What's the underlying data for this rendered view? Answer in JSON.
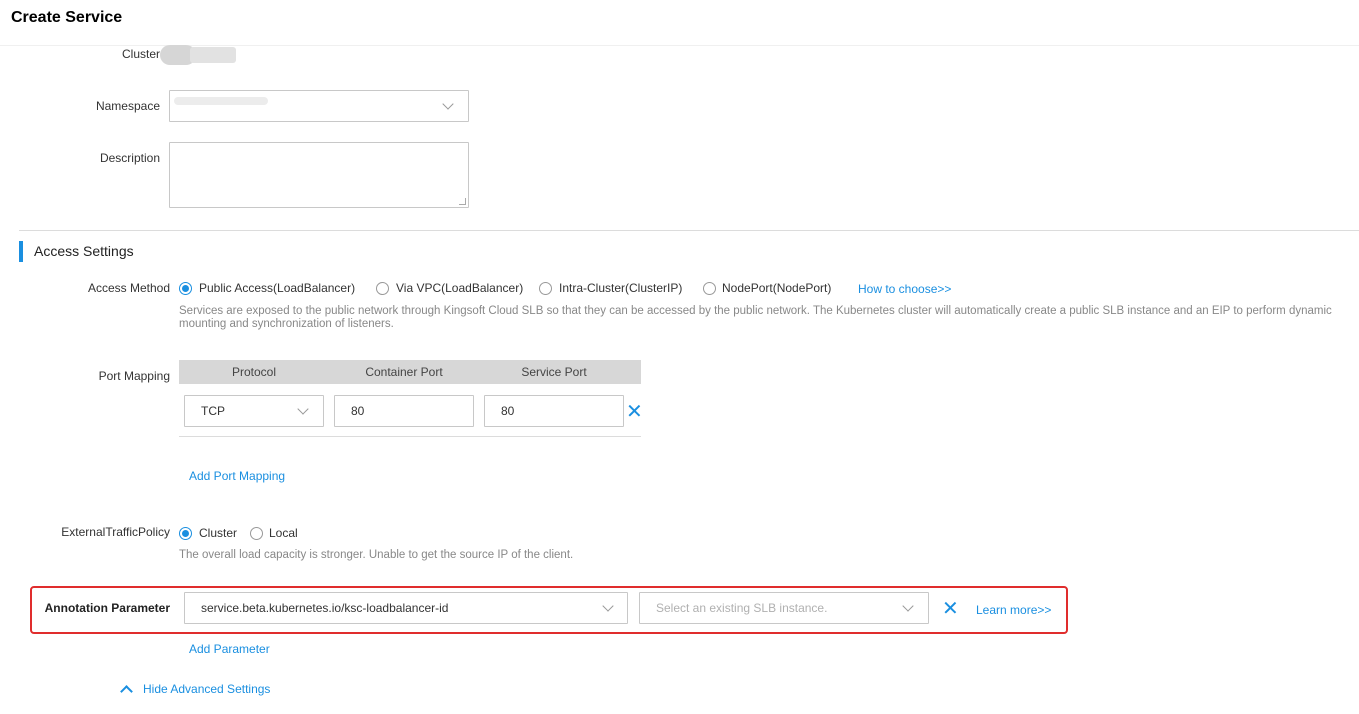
{
  "header": {
    "title": "Create Service"
  },
  "form": {
    "cluster_label": "Cluster",
    "namespace_label": "Namespace",
    "description_label": "Description"
  },
  "access": {
    "section_title": "Access Settings",
    "method_label": "Access Method",
    "options": [
      "Public Access(LoadBalancer)",
      "Via VPC(LoadBalancer)",
      "Intra-Cluster(ClusterIP)",
      "NodePort(NodePort)"
    ],
    "selected_index": 0,
    "how_to_choose": "How to choose>>",
    "description": "Services are exposed to the public network through Kingsoft Cloud SLB so that they can be accessed by the public network. The Kubernetes cluster will automatically create a public SLB instance and an EIP to perform dynamic mounting and synchronization of listeners."
  },
  "port_mapping": {
    "label": "Port Mapping",
    "columns": [
      "Protocol",
      "Container Port",
      "Service Port"
    ],
    "rows": [
      {
        "protocol": "TCP",
        "container_port": "80",
        "service_port": "80"
      }
    ],
    "add_label": "Add Port Mapping"
  },
  "traffic_policy": {
    "label": "ExternalTrafficPolicy",
    "options": [
      "Cluster",
      "Local"
    ],
    "selected_index": 0,
    "description": "The overall load capacity is stronger. Unable to get the source IP of the client."
  },
  "annotation": {
    "label": "Annotation Parameter",
    "key_value": "service.beta.kubernetes.io/ksc-loadbalancer-id",
    "value_placeholder": "Select an existing SLB instance.",
    "learn_more": "Learn more>>",
    "add_label": "Add Parameter"
  },
  "advanced": {
    "toggle_label": "Hide Advanced Settings"
  },
  "colors": {
    "accent": "#1a8fe0",
    "highlight": "#e02d2d"
  },
  "icons": [
    "chevron-down-icon",
    "close-icon",
    "chevron-up-icon"
  ]
}
